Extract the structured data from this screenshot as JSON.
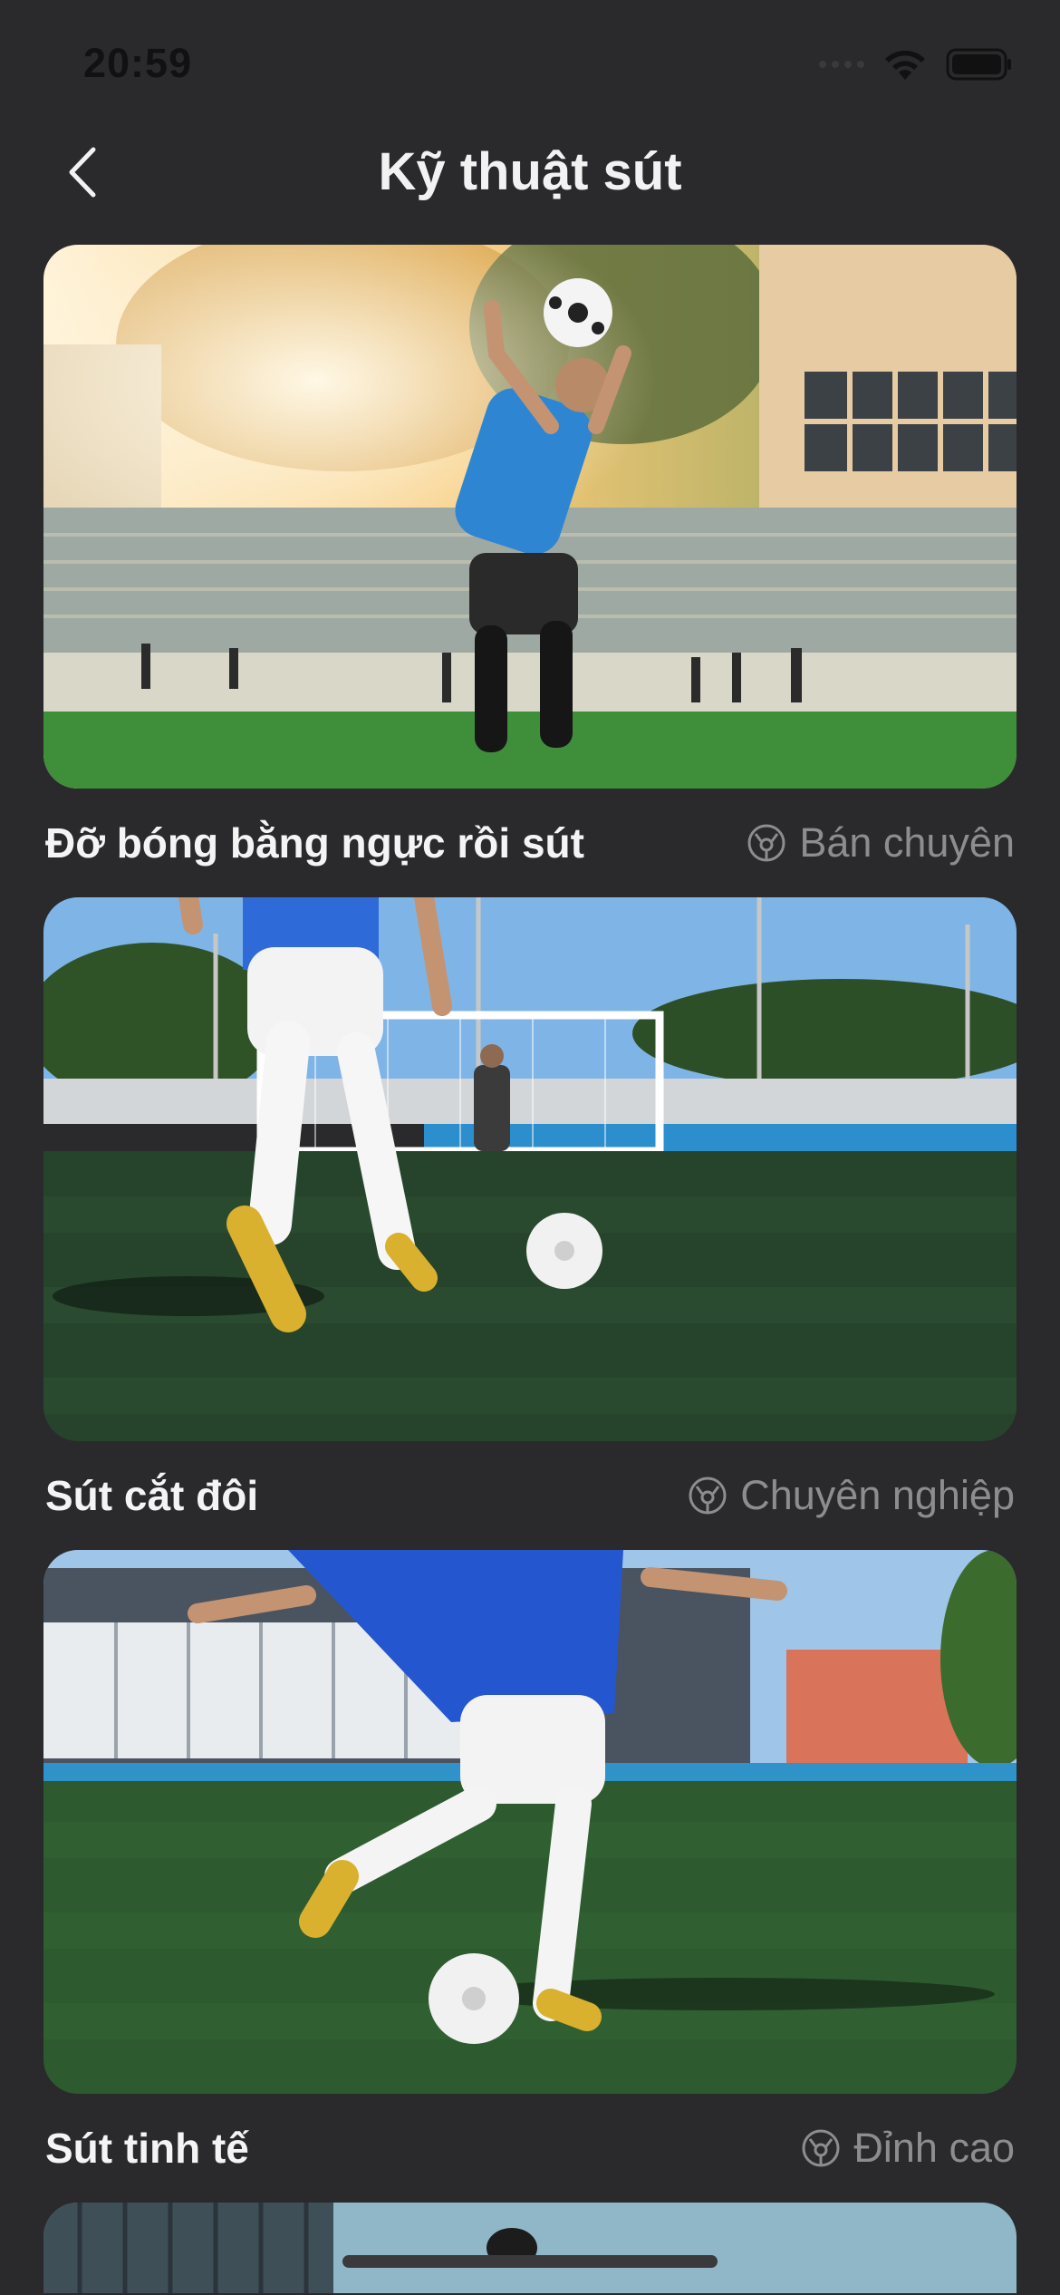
{
  "status_bar": {
    "time": "20:59"
  },
  "header": {
    "title": "Kỹ thuật sút"
  },
  "techniques": [
    {
      "name": "Đỡ bóng bằng ngực rồi sút",
      "level": "Bán chuyên"
    },
    {
      "name": "Sút cắt đôi",
      "level": "Chuyên nghiệp"
    },
    {
      "name": "Sút tinh tế",
      "level": "Đỉnh cao"
    }
  ],
  "icons": {
    "back": "chevron-left-icon",
    "level": "soccer-ball-icon",
    "wifi": "wifi-icon",
    "battery": "battery-icon"
  }
}
